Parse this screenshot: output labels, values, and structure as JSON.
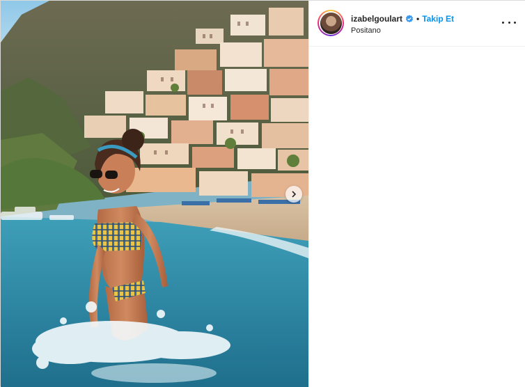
{
  "post": {
    "username": "izabelgoulart",
    "follow_label": "Takip Et",
    "separator": "•",
    "location": "Positano",
    "icons": {
      "verified": "verified-badge-icon",
      "more": "more-options-icon",
      "next": "next-photo-icon"
    },
    "colors": {
      "follow_blue": "#0095f6",
      "verified_blue": "#3897f0",
      "text": "#262626"
    }
  }
}
